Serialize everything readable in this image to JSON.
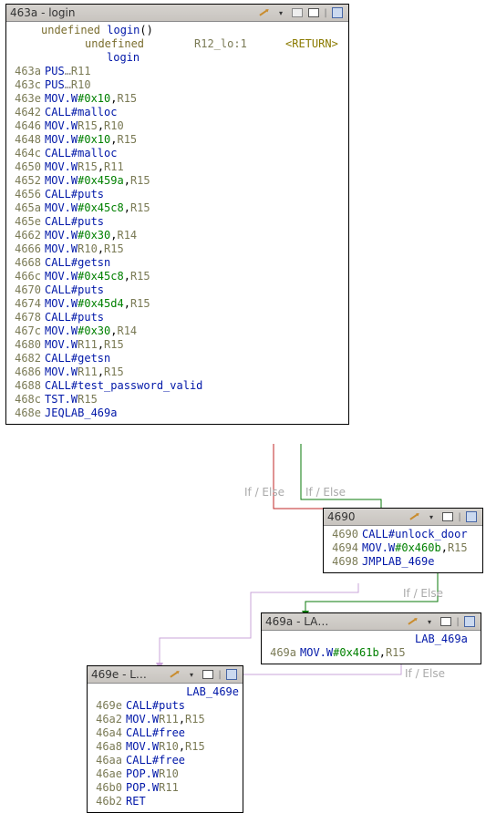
{
  "blocks": {
    "main": {
      "title": "463a - login",
      "sig_kw": "undefined",
      "sig_name": "login",
      "sig_paren": "()",
      "headcols": {
        "c1": "undefined",
        "c2": "R12_lo:1",
        "c3": "<RETURN>"
      },
      "subname": "login",
      "rows": [
        {
          "a": "463a",
          "m": "PUS",
          "d": "…",
          "ops": [
            {
              "t": "reg",
              "v": "R11"
            }
          ]
        },
        {
          "a": "463c",
          "m": "PUS",
          "d": "…",
          "ops": [
            {
              "t": "reg",
              "v": "R10"
            }
          ]
        },
        {
          "a": "463e",
          "m": "MOV.W",
          "ops": [
            {
              "t": "hex",
              "v": "#0x10"
            },
            {
              "t": "reg",
              "v": "R15"
            }
          ]
        },
        {
          "a": "4642",
          "m": "CALL",
          "ops": [
            {
              "t": "lbl",
              "v": "#malloc"
            }
          ]
        },
        {
          "a": "4646",
          "m": "MOV.W",
          "ops": [
            {
              "t": "reg",
              "v": "R15"
            },
            {
              "t": "reg",
              "v": "R10"
            }
          ]
        },
        {
          "a": "4648",
          "m": "MOV.W",
          "ops": [
            {
              "t": "hex",
              "v": "#0x10"
            },
            {
              "t": "reg",
              "v": "R15"
            }
          ]
        },
        {
          "a": "464c",
          "m": "CALL",
          "ops": [
            {
              "t": "lbl",
              "v": "#malloc"
            }
          ]
        },
        {
          "a": "4650",
          "m": "MOV.W",
          "ops": [
            {
              "t": "reg",
              "v": "R15"
            },
            {
              "t": "reg",
              "v": "R11"
            }
          ]
        },
        {
          "a": "4652",
          "m": "MOV.W",
          "ops": [
            {
              "t": "hex",
              "v": "#0x459a"
            },
            {
              "t": "reg",
              "v": "R15"
            }
          ]
        },
        {
          "a": "4656",
          "m": "CALL",
          "ops": [
            {
              "t": "lbl",
              "v": "#puts"
            }
          ]
        },
        {
          "a": "465a",
          "m": "MOV.W",
          "ops": [
            {
              "t": "hex",
              "v": "#0x45c8"
            },
            {
              "t": "reg",
              "v": "R15"
            }
          ]
        },
        {
          "a": "465e",
          "m": "CALL",
          "ops": [
            {
              "t": "lbl",
              "v": "#puts"
            }
          ]
        },
        {
          "a": "4662",
          "m": "MOV.W",
          "ops": [
            {
              "t": "hex",
              "v": "#0x30"
            },
            {
              "t": "reg",
              "v": "R14"
            }
          ]
        },
        {
          "a": "4666",
          "m": "MOV.W",
          "ops": [
            {
              "t": "reg",
              "v": "R10"
            },
            {
              "t": "reg",
              "v": "R15"
            }
          ]
        },
        {
          "a": "4668",
          "m": "CALL",
          "ops": [
            {
              "t": "lbl",
              "v": "#getsn"
            }
          ]
        },
        {
          "a": "466c",
          "m": "MOV.W",
          "ops": [
            {
              "t": "hex",
              "v": "#0x45c8"
            },
            {
              "t": "reg",
              "v": "R15"
            }
          ]
        },
        {
          "a": "4670",
          "m": "CALL",
          "ops": [
            {
              "t": "lbl",
              "v": "#puts"
            }
          ]
        },
        {
          "a": "4674",
          "m": "MOV.W",
          "ops": [
            {
              "t": "hex",
              "v": "#0x45d4"
            },
            {
              "t": "reg",
              "v": "R15"
            }
          ]
        },
        {
          "a": "4678",
          "m": "CALL",
          "ops": [
            {
              "t": "lbl",
              "v": "#puts"
            }
          ]
        },
        {
          "a": "467c",
          "m": "MOV.W",
          "ops": [
            {
              "t": "hex",
              "v": "#0x30"
            },
            {
              "t": "reg",
              "v": "R14"
            }
          ]
        },
        {
          "a": "4680",
          "m": "MOV.W",
          "ops": [
            {
              "t": "reg",
              "v": "R11"
            },
            {
              "t": "reg",
              "v": "R15"
            }
          ]
        },
        {
          "a": "4682",
          "m": "CALL",
          "ops": [
            {
              "t": "lbl",
              "v": "#getsn"
            }
          ]
        },
        {
          "a": "4686",
          "m": "MOV.W",
          "ops": [
            {
              "t": "reg",
              "v": "R11"
            },
            {
              "t": "reg",
              "v": "R15"
            }
          ]
        },
        {
          "a": "4688",
          "m": "CALL",
          "ops": [
            {
              "t": "lbl",
              "v": "#test_password_valid"
            }
          ]
        },
        {
          "a": "468c",
          "m": "TST.W",
          "ops": [
            {
              "t": "reg",
              "v": "R15"
            }
          ]
        },
        {
          "a": "468e",
          "m": "JEQ",
          "sp": "  ",
          "ops": [
            {
              "t": "lab",
              "v": "LAB_469a"
            }
          ]
        }
      ]
    },
    "b4690": {
      "title": "4690",
      "rows": [
        {
          "a": "4690",
          "m": "CALL",
          "ops": [
            {
              "t": "lbl",
              "v": "#unlock_door"
            }
          ]
        },
        {
          "a": "4694",
          "m": "MOV.W",
          "ops": [
            {
              "t": "hex",
              "v": "#0x460b"
            },
            {
              "t": "reg",
              "v": "R15"
            }
          ]
        },
        {
          "a": "4698",
          "m": "JMP",
          "sp": "  ",
          "ops": [
            {
              "t": "lab",
              "v": "LAB_469e"
            }
          ]
        }
      ]
    },
    "b469a": {
      "title": "469a - LA…",
      "label": "LAB_469a",
      "rows": [
        {
          "a": "469a",
          "m": "MOV.W",
          "ops": [
            {
              "t": "hex",
              "v": "#0x461b"
            },
            {
              "t": "reg",
              "v": "R15"
            }
          ]
        }
      ]
    },
    "b469e": {
      "title": "469e - L…",
      "label": "LAB_469e",
      "rows": [
        {
          "a": "469e",
          "m": "CALL",
          "ops": [
            {
              "t": "lbl",
              "v": "#puts"
            }
          ]
        },
        {
          "a": "46a2",
          "m": "MOV.W",
          "ops": [
            {
              "t": "reg",
              "v": "R11"
            },
            {
              "t": "reg",
              "v": "R15"
            }
          ]
        },
        {
          "a": "46a4",
          "m": "CALL",
          "ops": [
            {
              "t": "lbl",
              "v": "#free"
            }
          ]
        },
        {
          "a": "46a8",
          "m": "MOV.W",
          "ops": [
            {
              "t": "reg",
              "v": "R10"
            },
            {
              "t": "reg",
              "v": "R15"
            }
          ]
        },
        {
          "a": "46aa",
          "m": "CALL",
          "ops": [
            {
              "t": "lbl",
              "v": "#free"
            }
          ]
        },
        {
          "a": "46ae",
          "m": "POP.W",
          "ops": [
            {
              "t": "reg",
              "v": "R10"
            }
          ]
        },
        {
          "a": "46b0",
          "m": "POP.W",
          "ops": [
            {
              "t": "reg",
              "v": "R11"
            }
          ]
        },
        {
          "a": "46b2",
          "m": "RET",
          "ops": []
        }
      ]
    }
  },
  "edge_labels": {
    "e1": "If / Else",
    "e2": "If / Else",
    "e3": "If / Else",
    "e4": "If / Else"
  }
}
